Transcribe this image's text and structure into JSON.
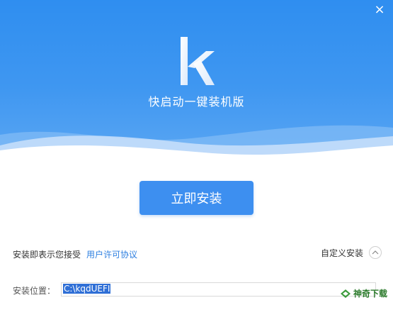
{
  "app": {
    "title": "快启动一键装机版",
    "logo_letter": "k"
  },
  "actions": {
    "install_label": "立即安装",
    "custom_install_label": "自定义安装"
  },
  "agreement": {
    "prefix": "安装即表示您接受",
    "link_text": "用户许可协议"
  },
  "location": {
    "label": "安装位置：",
    "value": "C:\\kqdUEFI"
  },
  "watermark": {
    "text": "神奇下载"
  },
  "colors": {
    "accent": "#3d8ff0",
    "hero_top": "#2f8ef0",
    "link": "#2d7fe0"
  }
}
